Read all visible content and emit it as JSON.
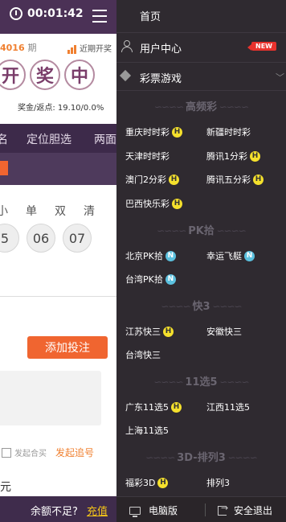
{
  "timer": "00:01:42",
  "issue": {
    "number": "4016",
    "unit": "期"
  },
  "recent_label": "近期开奖",
  "balls": [
    "开",
    "奖",
    "中"
  ],
  "bonus_label": "奖金/返点: 19.10/0.0%",
  "tabs": [
    "名",
    "定位胆选",
    "两面"
  ],
  "digit_filters": [
    "小",
    "单",
    "双",
    "清"
  ],
  "numbers": [
    "5",
    "06",
    "07"
  ],
  "add_bet_label": "添加投注",
  "joint_label": "发起合买",
  "chase_label": "发起追号",
  "yuan": "元",
  "balance_text": "余额不足?",
  "recharge_label": "充值",
  "drawer": {
    "home": "首页",
    "user_center": "用户中心",
    "new_badge": "NEW",
    "lottery_games": "彩票游戏",
    "sections": [
      {
        "title": "高频彩",
        "games": [
          {
            "name": "重庆时时彩",
            "badge": "H"
          },
          {
            "name": "新疆时时彩",
            "badge": ""
          },
          {
            "name": "天津时时彩",
            "badge": ""
          },
          {
            "name": "腾讯1分彩",
            "badge": "H"
          },
          {
            "name": "澳门2分彩",
            "badge": "H"
          },
          {
            "name": "腾讯五分彩",
            "badge": "H"
          },
          {
            "name": "巴西快乐彩",
            "badge": "H"
          }
        ]
      },
      {
        "title": "PK拾",
        "games": [
          {
            "name": "北京PK拾",
            "badge": "N"
          },
          {
            "name": "幸运飞艇",
            "badge": "N"
          },
          {
            "name": "台湾PK拾",
            "badge": "N"
          }
        ]
      },
      {
        "title": "快3",
        "games": [
          {
            "name": "江苏快三",
            "badge": "H"
          },
          {
            "name": "安徽快三",
            "badge": ""
          },
          {
            "name": "台湾快三",
            "badge": ""
          }
        ]
      },
      {
        "title": "11选5",
        "games": [
          {
            "name": "广东11选5",
            "badge": "H"
          },
          {
            "name": "江西11选5",
            "badge": ""
          },
          {
            "name": "上海11选5",
            "badge": ""
          }
        ]
      },
      {
        "title": "3D-排列3",
        "games": [
          {
            "name": "福彩3D",
            "badge": "H"
          },
          {
            "name": "排列3",
            "badge": ""
          }
        ]
      }
    ],
    "footer": {
      "pc_label": "电脑版",
      "logout_label": "安全退出"
    }
  },
  "colors": {
    "header": "#4b3156",
    "drawer": "#2f2a30",
    "accent": "#f06530",
    "hot_badge": "#f5e02c",
    "new_badge": "#5bc0de"
  }
}
